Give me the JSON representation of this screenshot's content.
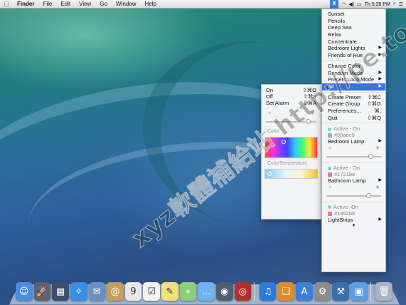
{
  "menubar": {
    "apple": "",
    "items": [
      "Finder",
      "File",
      "Edit",
      "View",
      "Go",
      "Window",
      "Help"
    ],
    "status_text": "Th 5:39 PM",
    "hue_icon": "hue-lamp-icon"
  },
  "menu": {
    "presets": [
      "Sunset",
      "Pencils",
      "Deep Sea",
      "Relax",
      "Concentrate",
      "Bedroom Lights",
      "Friends of Hue"
    ],
    "change_color": "Change Color",
    "random_mode": "Random Mode",
    "presets_loop_mode": "Presets Loop Mode",
    "all": "All",
    "actions": [
      {
        "label": "Create Preset",
        "shortcut": "⇧⌘C"
      },
      {
        "label": "Create Group",
        "shortcut": "⇧⌘G"
      },
      {
        "label": "Preferences...",
        "shortcut": "⌘,"
      },
      {
        "label": "Quit",
        "shortcut": "⇧⌘Q"
      }
    ],
    "lamps": [
      {
        "status": "Active - On",
        "hex": "#99aec9",
        "name": "Bedroom Lamp",
        "brightness": 0.82,
        "swatch": "#99aec9"
      },
      {
        "status": "Active - On",
        "hex": "#1721be",
        "name": "Bathroom Lamp",
        "brightness": 0.78,
        "swatch": "#e87a88"
      },
      {
        "status": "Active -On",
        "hex": "#1852b8",
        "name": "LightStrips",
        "brightness": 0.5,
        "swatch": "#e87a88"
      }
    ],
    "more_arrow": "▼"
  },
  "submenu": {
    "items": [
      {
        "label": "On",
        "shortcut": "⇧⌘O"
      },
      {
        "label": "Off",
        "shortcut": "⇧⌘F"
      },
      {
        "label": "Set Alarm",
        "shortcut": "⇧⌘A"
      }
    ],
    "color_label": "Color",
    "temperature_label": "ColorTemperature",
    "brightness": 0.85
  },
  "dock": {
    "apps": [
      {
        "name": "finder",
        "glyph": "☺",
        "color": "#4a8de0"
      },
      {
        "name": "launchpad",
        "glyph": "🚀",
        "color": "#5b6470"
      },
      {
        "name": "mission-control",
        "glyph": "▦",
        "color": "#3e4f6e"
      },
      {
        "name": "safari",
        "glyph": "✧",
        "color": "#3a8ee6"
      },
      {
        "name": "mail",
        "glyph": "✉",
        "color": "#6a8fc0"
      },
      {
        "name": "contacts",
        "glyph": "@",
        "color": "#c89c5a"
      },
      {
        "name": "calendar",
        "glyph": "9",
        "color": "#e8e8e8"
      },
      {
        "name": "reminders",
        "glyph": "☑",
        "color": "#f2f2f2"
      },
      {
        "name": "notes",
        "glyph": "✎",
        "color": "#f4e07a"
      },
      {
        "name": "maps",
        "glyph": "⌖",
        "color": "#8ccf7a"
      },
      {
        "name": "messages",
        "glyph": "…",
        "color": "#6fb4ef"
      },
      {
        "name": "facetime",
        "glyph": "◉",
        "color": "#4f5f6e"
      },
      {
        "name": "photo-booth",
        "glyph": "◎",
        "color": "#b03030"
      },
      {
        "name": "itunes",
        "glyph": "♫",
        "color": "#2a7bd8"
      },
      {
        "name": "ibooks",
        "glyph": "❑",
        "color": "#e08b2a"
      },
      {
        "name": "app-store",
        "glyph": "A",
        "color": "#3a7fd8"
      },
      {
        "name": "system-preferences",
        "glyph": "⚙",
        "color": "#8c8c8c"
      },
      {
        "name": "xcode",
        "glyph": "⚒",
        "color": "#3a6fa8"
      },
      {
        "name": "utilities",
        "glyph": "▣",
        "color": "#5aa0e0"
      },
      {
        "name": "trash",
        "glyph": "🗑",
        "color": "#a9b2bd"
      }
    ]
  },
  "watermark": {
    "line1": "xyz軟體補給站 http://pe.to"
  }
}
